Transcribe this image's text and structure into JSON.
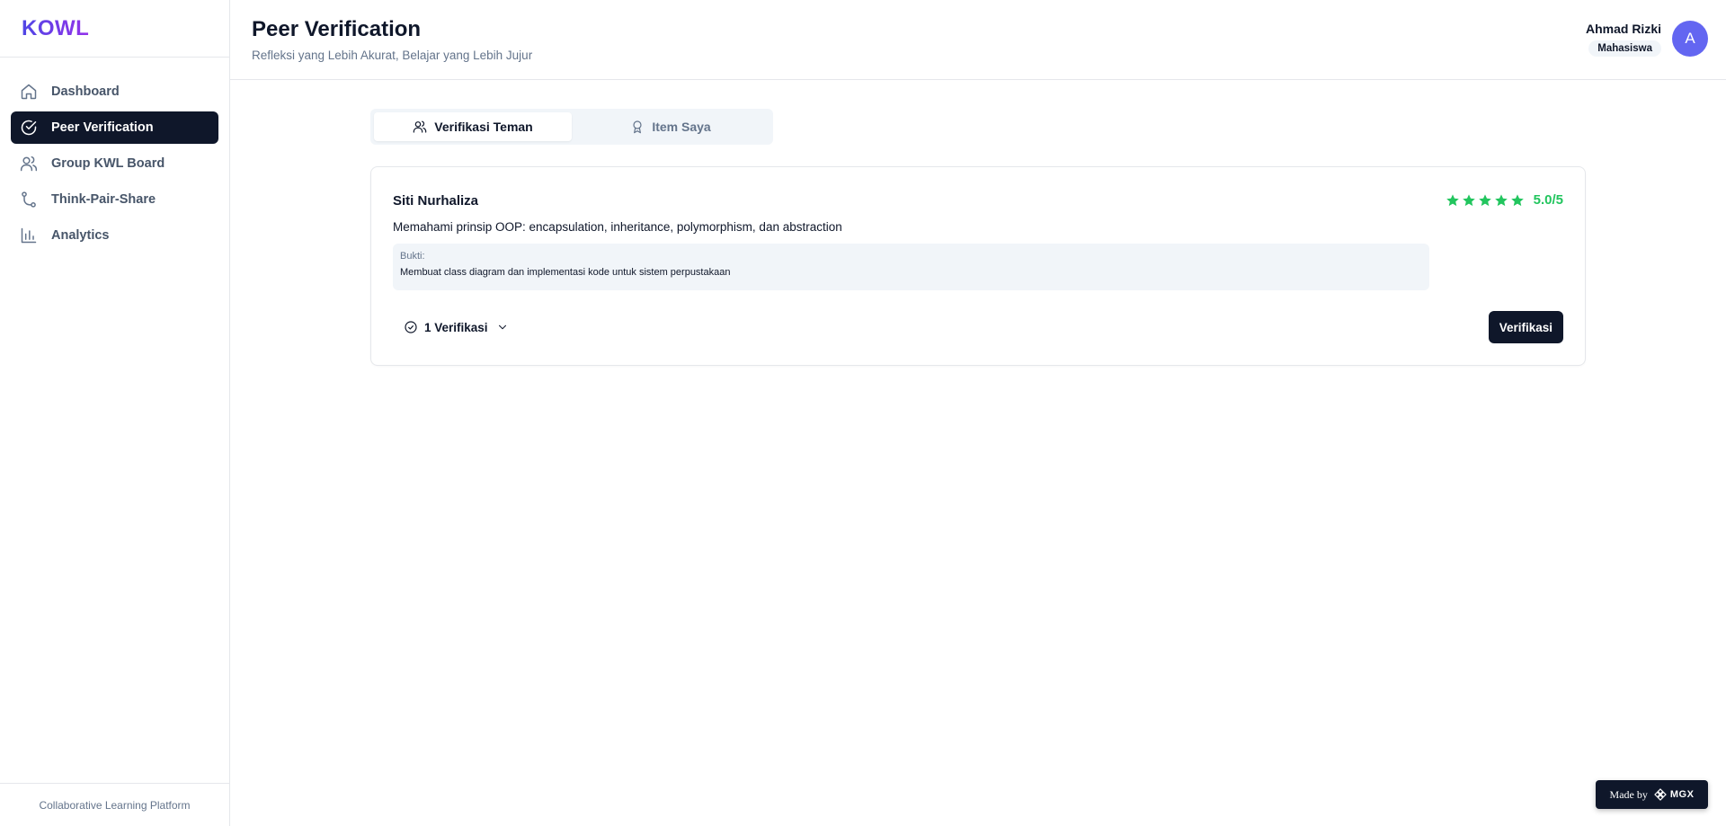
{
  "brand": {
    "name": "KOWL"
  },
  "sidebar": {
    "items": [
      {
        "label": "Dashboard",
        "icon": "home-icon",
        "active": false
      },
      {
        "label": "Peer Verification",
        "icon": "check-circle-icon",
        "active": true
      },
      {
        "label": "Group KWL Board",
        "icon": "users-icon",
        "active": false
      },
      {
        "label": "Think-Pair-Share",
        "icon": "git-branch-icon",
        "active": false
      },
      {
        "label": "Analytics",
        "icon": "bar-chart-icon",
        "active": false
      }
    ],
    "footer": "Collaborative Learning Platform"
  },
  "header": {
    "title": "Peer Verification",
    "subtitle": "Refleksi yang Lebih Akurat, Belajar yang Lebih Jujur"
  },
  "user": {
    "name": "Ahmad Rizki",
    "role": "Mahasiswa",
    "initial": "A",
    "avatar_color": "#6366f1"
  },
  "tabs": [
    {
      "label": "Verifikasi Teman",
      "icon": "users-icon",
      "active": true
    },
    {
      "label": "Item Saya",
      "icon": "award-icon",
      "active": false
    }
  ],
  "card": {
    "name": "Siti Nurhaliza",
    "stars": 5,
    "rating_text": "5.0/5",
    "description": "Memahami prinsip OOP: encapsulation, inheritance, polymorphism, dan abstraction",
    "evidence_label": "Bukti:",
    "evidence_text": "Membuat class diagram dan implementasi kode untuk sistem perpustakaan",
    "verification_count_label": "1 Verifikasi",
    "verify_button_label": "Verifikasi"
  },
  "badge": {
    "prefix": "Made by",
    "brand": "MGX"
  },
  "colors": {
    "primary": "#0f172a",
    "accent_green": "#22c55e",
    "brand_gradient_start": "#4f46e5",
    "brand_gradient_end": "#9333ea"
  }
}
